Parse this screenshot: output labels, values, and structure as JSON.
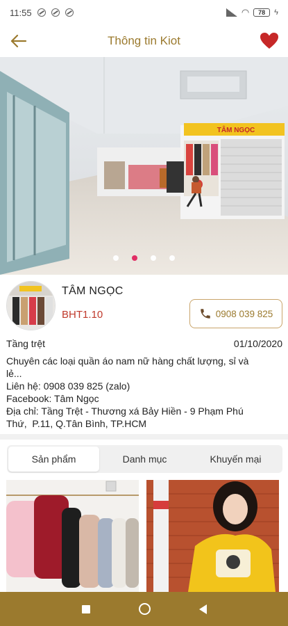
{
  "status_bar": {
    "time": "11:55",
    "battery": "78",
    "icons": [
      "notification-icon",
      "notification-icon",
      "notification-icon",
      "signal-icon",
      "wifi-icon",
      "battery-icon",
      "charging-icon"
    ]
  },
  "app_bar": {
    "title": "Thông tin Kiot",
    "back_icon": "arrow-left",
    "favorite_icon": "heart"
  },
  "hero": {
    "slide_count": 4,
    "active_index": 1,
    "sign_text": "TÂM NGỌC"
  },
  "shop": {
    "name": "TÂM NGỌC",
    "code": "BHT1.10",
    "phone": "0908 039 825",
    "floor": "Tầng trệt",
    "date": "01/10/2020",
    "description_lines": [
      "Chuyên các loại quần áo nam nữ hàng chất lượng, sỉ và",
      "lẻ...",
      "Liên hệ: 0908 039 825 (zalo)",
      "Facebook: Tâm Ngọc",
      "Địa chỉ: Tầng Trệt - Thương xá Bảy Hiền - 9 Phạm Phú",
      "Thứ,  P.11, Q.Tân Bình, TP.HCM"
    ]
  },
  "tabs": [
    {
      "label": "Sản phẩm",
      "active": true
    },
    {
      "label": "Danh mục",
      "active": false
    },
    {
      "label": "Khuyến mại",
      "active": false
    }
  ],
  "colors": {
    "accent": "#9b7a2e",
    "heart": "#c62828",
    "code": "#c0392b",
    "active_dot": "#e0245e"
  }
}
